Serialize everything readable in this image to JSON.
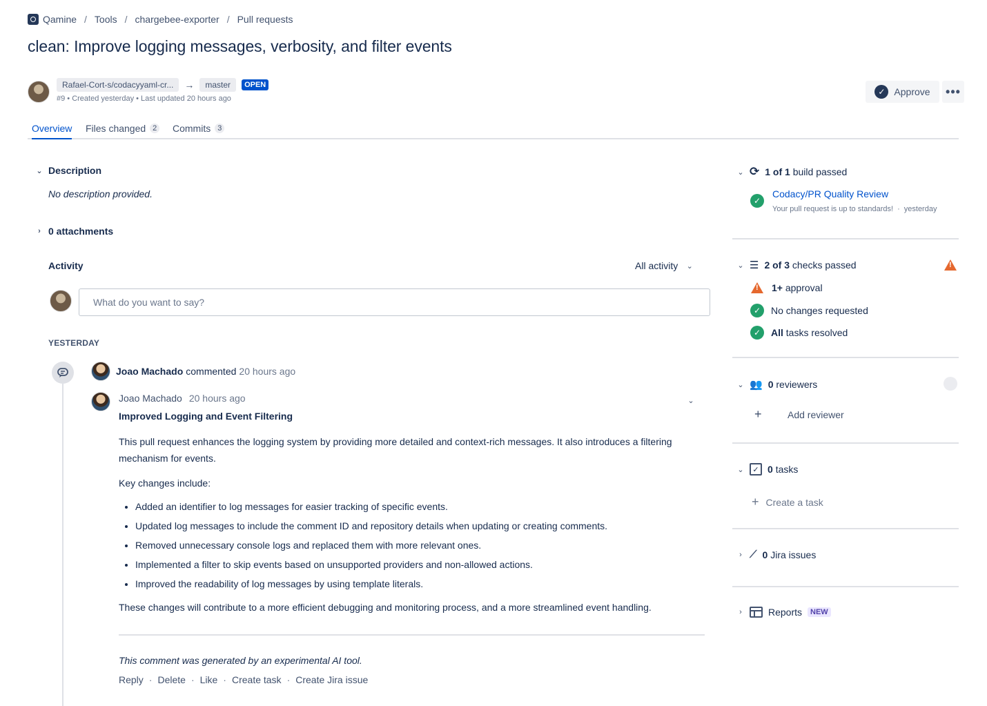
{
  "breadcrumb": [
    "Qamine",
    "Tools",
    "chargebee-exporter",
    "Pull requests"
  ],
  "title": "clean: Improve logging messages, verbosity, and filter events",
  "pr": {
    "source_branch": "Rafael-Cort-s/codacyyaml-cr...",
    "target_branch": "master",
    "state": "OPEN",
    "meta": "#9 • Created yesterday • Last updated 20 hours ago"
  },
  "header_actions": {
    "approve": "Approve",
    "more": "•••"
  },
  "tabs": [
    {
      "label": "Overview",
      "count": ""
    },
    {
      "label": "Files changed",
      "count": "2"
    },
    {
      "label": "Commits",
      "count": "3"
    }
  ],
  "description": {
    "heading": "Description",
    "text": "No description provided."
  },
  "attachments": "0 attachments",
  "activity": {
    "heading": "Activity",
    "filter": "All activity",
    "input_placeholder": "What do you want to say?",
    "day_label": "YESTERDAY"
  },
  "comment": {
    "summary_author": "Joao Machado",
    "summary_verb": "commented",
    "summary_time": "20 hours ago",
    "author": "Joao Machado",
    "time": "20 hours ago",
    "heading": "Improved Logging and Event Filtering",
    "intro": "This pull request enhances the logging system by providing more detailed and context-rich messages. It also introduces a filtering mechanism for events.",
    "key_changes_label": "Key changes include:",
    "changes": [
      "Added an identifier to log messages for easier tracking of specific events.",
      "Updated log messages to include the comment ID and repository details when updating or creating comments.",
      "Removed unnecessary console logs and replaced them with more relevant ones.",
      "Implemented a filter to skip events based on unsupported providers and non-allowed actions.",
      "Improved the readability of log messages by using template literals."
    ],
    "outro": "These changes will contribute to a more efficient debugging and monitoring process, and a more streamlined event handling.",
    "footnote": "This comment was generated by an experimental AI tool.",
    "actions": [
      "Reply",
      "Delete",
      "Like",
      "Create task",
      "Create Jira issue"
    ]
  },
  "sidebar": {
    "builds": {
      "count": "1 of 1",
      "label": "build passed",
      "item_name": "Codacy/PR Quality Review",
      "item_status": "Your pull request is up to standards!",
      "item_time": "yesterday"
    },
    "checks": {
      "count": "2 of 3",
      "label": "checks passed",
      "items": [
        {
          "bold": "1+",
          "text": "approval",
          "status": "warning"
        },
        {
          "bold": "",
          "text": "No changes requested",
          "status": "success"
        },
        {
          "bold": "All",
          "text": "tasks resolved",
          "status": "success"
        }
      ]
    },
    "reviewers": {
      "count": "0",
      "label": "reviewers",
      "add": "Add reviewer"
    },
    "tasks": {
      "count": "0",
      "label": "tasks",
      "add": "Create a task"
    },
    "jira": {
      "count": "0",
      "label": "Jira issues"
    },
    "reports": {
      "label": "Reports",
      "badge": "NEW"
    }
  },
  "colors": {
    "accent": "#0052cc",
    "success": "#22a06b",
    "warning": "#e5682e",
    "text": "#172b4d"
  }
}
